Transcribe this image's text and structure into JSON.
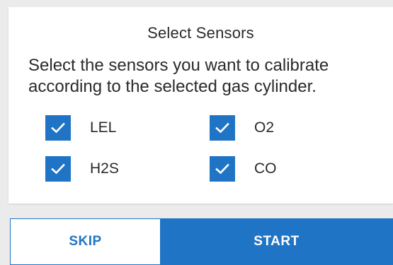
{
  "dialog": {
    "title": "Select Sensors",
    "description": "Select the sensors you want to calibrate according to the selected gas cylinder.",
    "sensors": [
      {
        "label": "LEL",
        "checked": true
      },
      {
        "label": "O2",
        "checked": true
      },
      {
        "label": "H2S",
        "checked": true
      },
      {
        "label": "CO",
        "checked": true
      }
    ]
  },
  "actions": {
    "skip_label": "SKIP",
    "start_label": "START"
  },
  "colors": {
    "accent": "#1f74c5",
    "background": "#ebebeb",
    "card": "#ffffff",
    "text": "#2a2a2a"
  },
  "icons": {
    "checkbox_mark": "checkmark-icon"
  }
}
